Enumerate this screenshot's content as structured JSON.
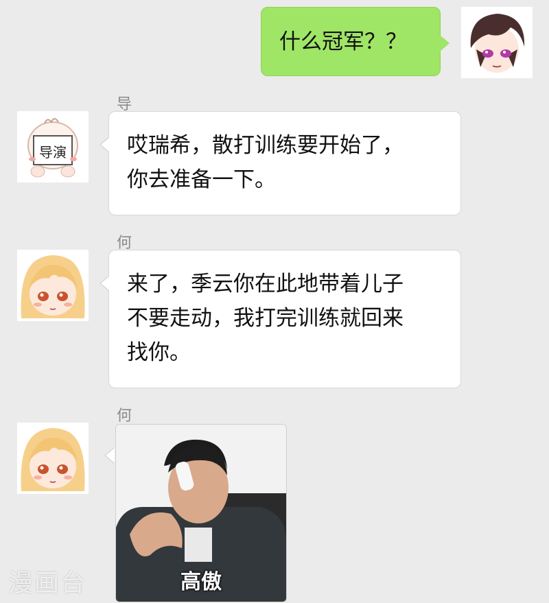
{
  "conversation": {
    "messages": [
      {
        "side": "right",
        "sender": "",
        "avatar": "boy-avatar",
        "lines": [
          "什么冠军？？"
        ]
      },
      {
        "side": "left",
        "sender": "导演",
        "avatar": "director-avatar",
        "avatar_text": "导演",
        "lines": [
          "哎瑞希，散打训练要开始了，",
          "你去准备一下。"
        ]
      },
      {
        "side": "left",
        "sender": "何瑞希",
        "avatar": "girl-avatar",
        "lines": [
          "来了，季云你在此地带着儿子",
          "不要走动，我打完训练就回来",
          "找你。"
        ]
      },
      {
        "side": "left",
        "sender": "何瑞希",
        "avatar": "girl-avatar",
        "image_caption": "高傲",
        "image_icon": "man-on-phone-image"
      }
    ]
  },
  "watermark": "漫画台",
  "colors": {
    "background": "#ebebeb",
    "outgoing_bubble": "#9fe566",
    "incoming_bubble": "#ffffff",
    "sender_name": "#8a8a8a"
  }
}
